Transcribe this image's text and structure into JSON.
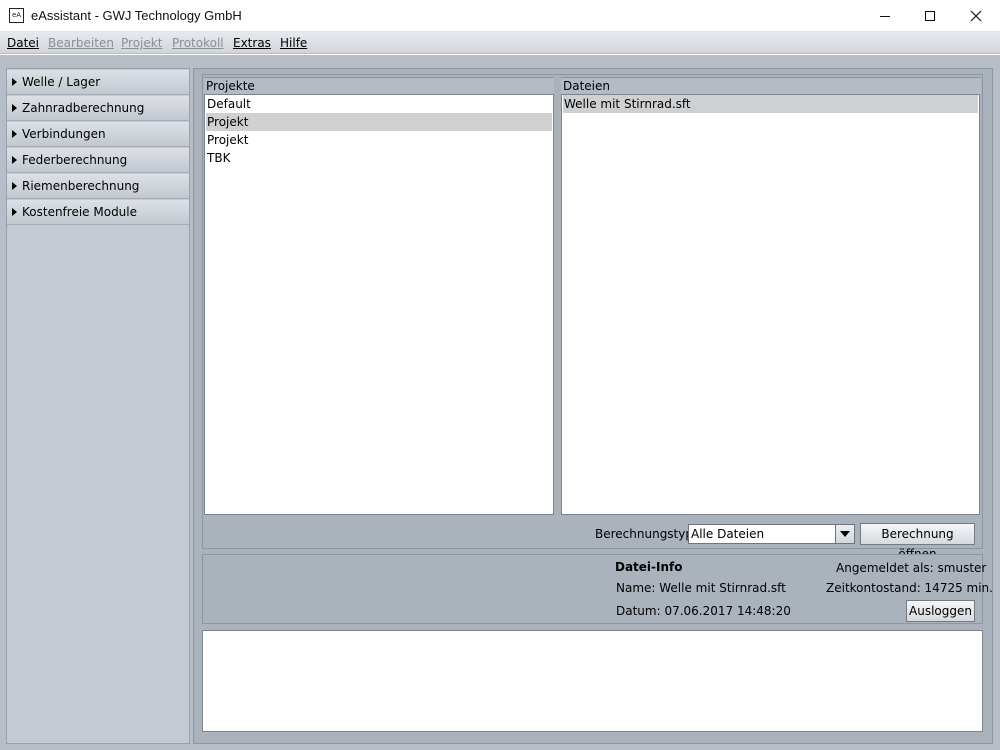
{
  "window": {
    "title": "eAssistant - GWJ Technology GmbH",
    "icon_text": "eA",
    "controls": [
      "minimize-icon",
      "maximize-icon",
      "close-icon"
    ]
  },
  "menu": [
    {
      "label": "Datei",
      "mnemonic": "D",
      "enabled": true
    },
    {
      "label": "Bearbeiten",
      "mnemonic": "B",
      "enabled": false
    },
    {
      "label": "Projekt",
      "mnemonic": "P",
      "enabled": false
    },
    {
      "label": "Protokoll",
      "mnemonic": "r",
      "enabled": false
    },
    {
      "label": "Extras",
      "mnemonic": "x",
      "enabled": true
    },
    {
      "label": "Hilfe",
      "mnemonic": "H",
      "enabled": true
    }
  ],
  "sidebar": {
    "items": [
      {
        "label": "Welle / Lager"
      },
      {
        "label": "Zahnradberechnung"
      },
      {
        "label": "Verbindungen"
      },
      {
        "label": "Federberechnung"
      },
      {
        "label": "Riemenberechnung"
      },
      {
        "label": "Kostenfreie Module"
      }
    ]
  },
  "projects": {
    "header": "Projekte",
    "items": [
      "Default",
      "Projekt",
      "Projekt",
      "TBK"
    ],
    "selected_index": 1
  },
  "files": {
    "header": "Dateien",
    "items": [
      "Welle mit Stirnrad.sft"
    ],
    "selected_index": 0
  },
  "controls": {
    "calc_type_label": "Berechnungstyp",
    "calc_type_value": "Alle Dateien",
    "open_button": "Berechnung öffnen"
  },
  "file_info": {
    "title": "Datei-Info",
    "name": "Name: Welle mit Stirnrad.sft",
    "date": "Datum: 07.06.2017 14:48:20",
    "logged_in": "Angemeldet als: smuster",
    "time_account": "Zeitkontostand: 14725 min.",
    "logout_button": "Ausloggen"
  },
  "colors": {
    "workspace": "#b8bec7",
    "panel": "#aab2bc",
    "selection": "#cfd0d2"
  }
}
